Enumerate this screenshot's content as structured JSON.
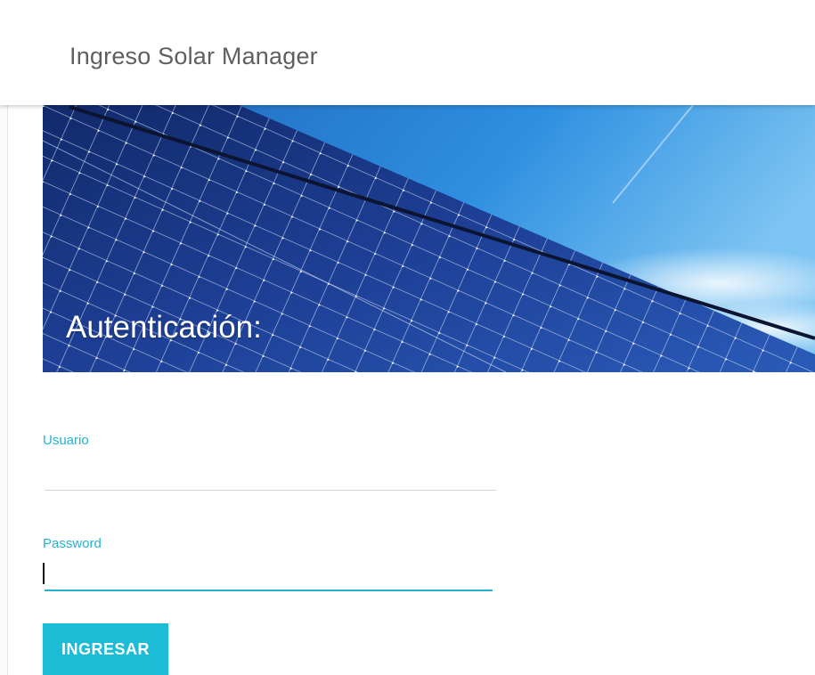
{
  "app": {
    "title": "Ingreso Solar Manager"
  },
  "hero": {
    "title": "Autenticación:",
    "image": "solar-panels-under-blue-sky"
  },
  "form": {
    "username": {
      "label": "Usuario",
      "value": ""
    },
    "password": {
      "label": "Password",
      "value": ""
    },
    "submit_label": "INGRESAR"
  },
  "colors": {
    "accent": "#26b3cf",
    "button": "#1cbcd6",
    "title_text": "#5f5f5f"
  }
}
